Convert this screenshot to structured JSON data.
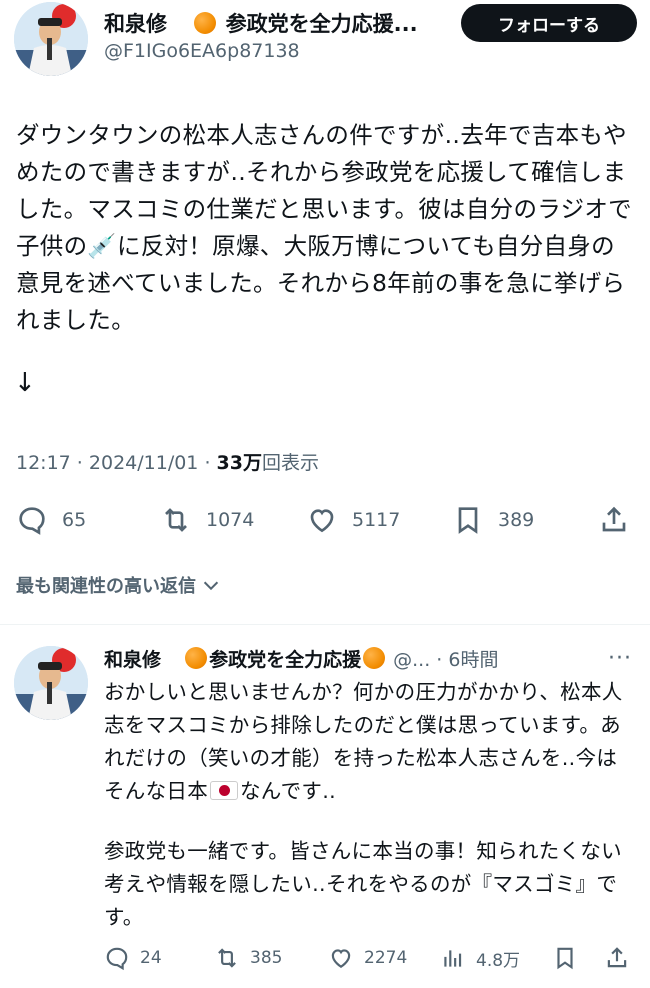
{
  "tweet": {
    "author_name": "和泉修",
    "author_suffix": "参政党を全力応援...",
    "handle": "@F1IGo6EA6p87138",
    "follow_label": "フォローする",
    "text": "ダウンタウンの松本人志さんの件ですが‥去年で吉本もやめたので書きますが‥それから参政党を応援して確信しました。マスコミの仕業だと思います。彼は自分のラジオで子供の",
    "text_emoji": "💉",
    "text_rest": "に反対！原爆、大阪万博についても自分自身の意見を述べていました。それから8年前の事を急に挙げられました。",
    "arrow": "↓",
    "time": "12:17",
    "date": "2024/11/01",
    "views_count": "33万",
    "views_label": "回表示",
    "metrics": {
      "replies": "65",
      "retweets": "1074",
      "likes": "5117",
      "bookmarks": "389"
    }
  },
  "relevant_label": "最も関連性の高い返信",
  "reply": {
    "author_name": "和泉修",
    "author_suffix": "参政党を全力応援",
    "handle": "@...",
    "time_ago": "6時間",
    "more": "···",
    "text1": "おかしいと思いませんか？何かの圧力がかかり、松本人志をマスコミから排除したのだと僕は思っています。あれだけの（笑いの才能）を持った松本人志さんを‥今はそんな日本",
    "text1_end": "なんです‥",
    "text2": "参政党も一緒です。皆さんに本当の事！知られたくない考えや情報を隠したい‥それをやるのが『マスゴミ』です。",
    "metrics": {
      "replies": "24",
      "retweets": "385",
      "likes": "2274",
      "views": "4.8万"
    }
  },
  "colors": {
    "text": "#0f1419",
    "secondary": "#536471",
    "follow_bg": "#0f1419",
    "accent_orange": "#f28c00",
    "flag_red": "#bc002d",
    "divider": "#eff3f4"
  }
}
